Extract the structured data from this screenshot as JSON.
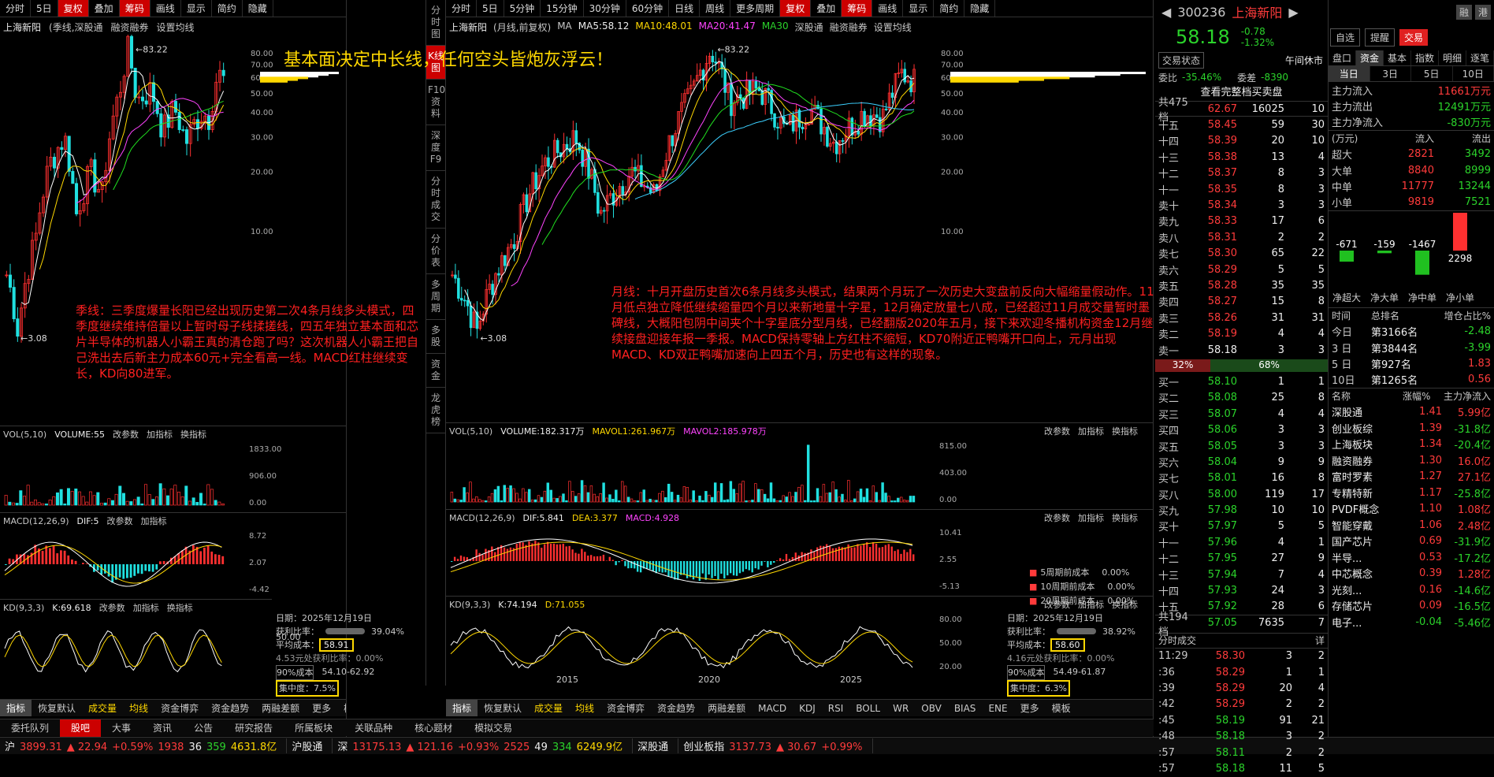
{
  "left_panel": {
    "toolbar": [
      "分时",
      "5日",
      "复权",
      "叠加",
      "筹码",
      "画线",
      "显示",
      "简约",
      "隐藏"
    ],
    "stock_label": "上海新阳",
    "chart_mode": "(季线,深股通",
    "margin_label": "融资融券",
    "ma_setting": "设置均线",
    "high_label": "83.22",
    "low_label": "3.08",
    "y_ticks": [
      "80.00",
      "70.00",
      "60.00",
      "50.00",
      "40.00",
      "30.00",
      "20.00",
      "10.00"
    ],
    "annotation": "季线：三季度爆量长阳已经出现历史第二次4条月线多头模式，四季度继续维持倍量以上暂时母子线揉搓线，四五年独立基本面和芯片半导体的机器人小霸王真的清仓跑了吗？这次机器人小霸王把自己洗出去后新主力成本60元+完全看高一线。MACD红柱继续变长，KD向80进军。",
    "vol": {
      "title": "VOL(5,10)",
      "value": "VOLUME:55",
      "ticks": [
        "1833.00",
        "906.00",
        "0.00"
      ]
    },
    "macd": {
      "title": "MACD(12,26,9)",
      "value": "DIF:5",
      "ticks": [
        "8.72",
        "2.07",
        "-4.42"
      ]
    },
    "kd": {
      "title": "KD(9,3,3)",
      "value": "K:69.618",
      "ticks": [
        "50.00"
      ]
    },
    "panel_btns": [
      "改参数",
      "加指标",
      "换指标"
    ],
    "chip": {
      "date": "日期：2025年12月19日",
      "profit_label": "获利比率：",
      "profit": "39.04%",
      "avg_label": "平均成本：",
      "avg": "58.91",
      "line1": "4.53元处获利比率：0.00%",
      "cost_pct": "90%成本",
      "range": "54.10-62.92",
      "conc_label": "集中度：",
      "conc": "7.5%"
    },
    "bottom_tabs": [
      "指标",
      "恢复默认",
      "成交量",
      "均线",
      "资金博弈",
      "资金趋势",
      "两融差额",
      "更多",
      "模板"
    ]
  },
  "center_panel": {
    "toolbar": [
      "分时",
      "5日",
      "5分钟",
      "15分钟",
      "30分钟",
      "60分钟",
      "日线",
      "周线",
      "更多周期",
      "复权",
      "叠加",
      "筹码",
      "画线",
      "显示",
      "简约",
      "隐藏"
    ],
    "stock_label": "上海新阳",
    "chart_mode": "(月线,前复权)",
    "ma_label": "MA",
    "ma5": "MA5:58.12",
    "ma10": "MA10:48.01",
    "ma20": "MA20:41.47",
    "ma30": "MA30",
    "sgt": "深股通",
    "margin_label": "融资融券",
    "ma_setting": "设置均线",
    "high_label": "83.22",
    "low_label": "3.08",
    "y_ticks": [
      "80.00",
      "70.00",
      "60.00",
      "50.00",
      "40.00",
      "30.00",
      "20.00",
      "10.00"
    ],
    "annotation": "月线：十月开盘历史首次6条月线多头模式，结果两个月玩了一次历史大变盘前反向大幅缩量假动作。11月低点独立降低继续缩量四个月以来新地量十字星，12月确定放量七八成，已经超过11月成交量暂时墨碑线，大概阳包阴中间夹个十字星底分型月线，已经翻版2020年五月，接下来欢迎冬播机构资金12月继续接盘迎接年报一季报。MACD保持零轴上方红柱不缩短，KD70附近正鸭嘴开口向上，元月出现MACD、KD双正鸭嘴加速向上四五个月，历史也有这样的现象。",
    "vol": {
      "title": "VOL(5,10)",
      "v1": "VOLUME:182.317万",
      "v2": "MAVOL1:261.967万",
      "v3": "MAVOL2:185.978万",
      "ticks": [
        "815.00",
        "403.00",
        "0.00"
      ]
    },
    "macd": {
      "title": "MACD(12,26,9)",
      "dif": "DIF:5.841",
      "dea": "DEA:3.377",
      "macd": "MACD:4.928",
      "ticks": [
        "10.41",
        "2.55",
        "-5.13"
      ]
    },
    "kd": {
      "title": "KD(9,3,3)",
      "k": "K:74.194",
      "d": "D:71.055",
      "ticks": [
        "80.00",
        "50.00",
        "20.00"
      ]
    },
    "panel_btns": [
      "改参数",
      "加指标",
      "换指标"
    ],
    "x_labels": [
      "2015",
      "2020",
      "2025"
    ],
    "period_costs": [
      {
        "label": "5周期前成本",
        "val": "0.00%"
      },
      {
        "label": "10周期前成本",
        "val": "0.00%"
      },
      {
        "label": "20周期前成本",
        "val": "0.00%"
      }
    ],
    "chip": {
      "date": "日期：2025年12月19日",
      "profit_label": "获利比率：",
      "profit": "38.92%",
      "avg_label": "平均成本：",
      "avg": "58.60",
      "line1": "4.16元处获利比率：0.00%",
      "cost_pct": "90%成本",
      "range": "54.49-61.87",
      "conc_label": "集中度：",
      "conc": "6.3%"
    },
    "bottom_tabs": [
      "指标",
      "恢复默认",
      "成交量",
      "均线",
      "资金博弈",
      "资金趋势",
      "两融差额",
      "MACD",
      "KDJ",
      "RSI",
      "BOLL",
      "WR",
      "OBV",
      "BIAS",
      "ENE",
      "更多",
      "模板"
    ]
  },
  "side_tabs": [
    "分时图",
    "K线图",
    "F10资料",
    "深度F9",
    "分时成交",
    "分价表",
    "多周期",
    "多股",
    "资金",
    "龙虎榜"
  ],
  "title_banner": "基本面决定中长线，任何空头皆炮灰浮云！",
  "info_tabs": [
    "委托队列",
    "股吧",
    "大事",
    "资讯",
    "公告",
    "研究报告",
    "所属板块",
    "关联品种",
    "核心题材",
    "模拟交易"
  ],
  "status_bar": [
    {
      "name": "沪",
      "val": "3899.31",
      "chg": "▲ 22.94",
      "pct": "+0.59%",
      "n1": "1938",
      "n2": "36",
      "n3": "359",
      "amt": "4631.8亿"
    },
    {
      "name": "沪股通",
      "val": "",
      "chg": "",
      "pct": "",
      "n1": "",
      "n2": "",
      "n3": "",
      "amt": ""
    },
    {
      "name": "深",
      "val": "13175.13",
      "chg": "▲ 121.16",
      "pct": "+0.93%",
      "n1": "2525",
      "n2": "49",
      "n3": "334",
      "amt": "6249.9亿"
    },
    {
      "name": "深股通",
      "val": "",
      "chg": "",
      "pct": "",
      "n1": "",
      "n2": "",
      "n3": "",
      "amt": ""
    },
    {
      "name": "创业板指",
      "val": "3137.73",
      "chg": "▲ 30.67",
      "pct": "+0.99%",
      "n1": "",
      "n2": "",
      "n3": "",
      "amt": ""
    }
  ],
  "quote": {
    "code": "300236",
    "name": "上海新阳",
    "tag1": "融",
    "tag2": "港",
    "price": "58.18",
    "change": "-0.78",
    "pct": "-1.32%",
    "btn_watch": "自选",
    "btn_alert": "提醒",
    "btn_trade": "交易",
    "trade_state_label": "交易状态",
    "trade_state": "午间休市",
    "weibi_label": "委比",
    "weibi": "-35.46%",
    "weicha_label": "委差",
    "weicha": "-8390",
    "full_book": "查看完整档买卖盘",
    "ask_total": {
      "label": "共475档",
      "price": "62.67",
      "vol": "16025",
      "n": "10"
    },
    "asks": [
      [
        "十五",
        "58.45",
        "59",
        "30"
      ],
      [
        "十四",
        "58.39",
        "20",
        "10"
      ],
      [
        "十三",
        "58.38",
        "13",
        "4"
      ],
      [
        "十二",
        "58.37",
        "8",
        "3"
      ],
      [
        "十一",
        "58.35",
        "8",
        "3"
      ],
      [
        "卖十",
        "58.34",
        "3",
        "3"
      ],
      [
        "卖九",
        "58.33",
        "17",
        "6"
      ],
      [
        "卖八",
        "58.31",
        "2",
        "2"
      ],
      [
        "卖七",
        "58.30",
        "65",
        "22"
      ],
      [
        "卖六",
        "58.29",
        "5",
        "5"
      ],
      [
        "卖五",
        "58.28",
        "35",
        "35"
      ],
      [
        "卖四",
        "58.27",
        "15",
        "8"
      ],
      [
        "卖三",
        "58.26",
        "31",
        "31"
      ],
      [
        "卖二",
        "58.19",
        "4",
        "4"
      ],
      [
        "卖一",
        "58.18",
        "3",
        "3"
      ]
    ],
    "ratio_bid": "32%",
    "ratio_ask": "68%",
    "bids": [
      [
        "买一",
        "58.10",
        "1",
        "1"
      ],
      [
        "买二",
        "58.08",
        "25",
        "8"
      ],
      [
        "买三",
        "58.07",
        "4",
        "4"
      ],
      [
        "买四",
        "58.06",
        "3",
        "3"
      ],
      [
        "买五",
        "58.05",
        "3",
        "3"
      ],
      [
        "买六",
        "58.04",
        "9",
        "9"
      ],
      [
        "买七",
        "58.01",
        "16",
        "8"
      ],
      [
        "买八",
        "58.00",
        "119",
        "17"
      ],
      [
        "买九",
        "57.98",
        "10",
        "10"
      ],
      [
        "买十",
        "57.97",
        "5",
        "5"
      ],
      [
        "十一",
        "57.96",
        "4",
        "1"
      ],
      [
        "十二",
        "57.95",
        "27",
        "9"
      ],
      [
        "十三",
        "57.94",
        "7",
        "4"
      ],
      [
        "十四",
        "57.93",
        "24",
        "3"
      ],
      [
        "十五",
        "57.92",
        "28",
        "6"
      ]
    ],
    "bid_total": {
      "label": "共194档",
      "price": "57.05",
      "vol": "7635",
      "n": "7"
    },
    "ticks_title": "分时成交",
    "ticks_btn": "详",
    "ticks": [
      [
        "11:29",
        "58.30",
        "3",
        "2"
      ],
      [
        ":36",
        "58.29",
        "1",
        "1"
      ],
      [
        ":39",
        "58.29",
        "20",
        "4"
      ],
      [
        ":42",
        "58.29",
        "2",
        "2"
      ],
      [
        ":45",
        "58.19",
        "91",
        "21"
      ],
      [
        ":48",
        "58.18",
        "3",
        "2"
      ],
      [
        ":57",
        "58.11",
        "2",
        "2"
      ],
      [
        ":57",
        "58.18",
        "11",
        "5"
      ]
    ]
  },
  "funds": {
    "tabs": [
      "盘口",
      "资金",
      "基本",
      "指数",
      "明细",
      "逐笔"
    ],
    "subtabs": [
      "当日",
      "3日",
      "5日",
      "10日"
    ],
    "main_in_label": "主力流入",
    "main_in": "11661万元",
    "main_out_label": "主力流出",
    "main_out": "12491万元",
    "main_net_label": "主力净流入",
    "main_net": "-830万元",
    "unit": "(万元)",
    "col_in": "流入",
    "col_out": "流出",
    "rows": [
      [
        "超大",
        "2821",
        "3492"
      ],
      [
        "大单",
        "8840",
        "8999"
      ],
      [
        "中单",
        "11777",
        "13244"
      ],
      [
        "小单",
        "9819",
        "7521"
      ]
    ],
    "bar_vals": [
      "-671",
      "-159",
      "-1467",
      "2298"
    ],
    "bar_labels": [
      "净超大",
      "净大单",
      "净中单",
      "净小单"
    ],
    "rank_head": [
      "时间",
      "总排名",
      "增仓占比%"
    ],
    "ranks": [
      [
        "今日",
        "第3166名",
        "-2.48"
      ],
      [
        "3 日",
        "第3844名",
        "-3.99"
      ],
      [
        "5 日",
        "第927名",
        "1.83"
      ],
      [
        "10日",
        "第1265名",
        "0.56"
      ]
    ],
    "sector_head": [
      "名称",
      "涨幅%",
      "主力净流入"
    ],
    "sectors": [
      [
        "深股通",
        "1.41",
        "5.99亿"
      ],
      [
        "创业板综",
        "1.39",
        "-31.8亿"
      ],
      [
        "上海板块",
        "1.34",
        "-20.4亿"
      ],
      [
        "融资融券",
        "1.30",
        "16.0亿"
      ],
      [
        "富时罗素",
        "1.27",
        "27.1亿"
      ],
      [
        "专精特新",
        "1.17",
        "-25.8亿"
      ],
      [
        "PVDF概念",
        "1.10",
        "1.08亿"
      ],
      [
        "智能穿戴",
        "1.06",
        "2.48亿"
      ],
      [
        "国产芯片",
        "0.69",
        "-31.9亿"
      ],
      [
        "半导...",
        "0.53",
        "-17.2亿"
      ],
      [
        "中芯概念",
        "0.39",
        "1.28亿"
      ],
      [
        "光刻...",
        "0.16",
        "-14.6亿"
      ],
      [
        "存储芯片",
        "0.09",
        "-16.5亿"
      ],
      [
        "电子...",
        "-0.04",
        "-5.46亿"
      ]
    ]
  }
}
